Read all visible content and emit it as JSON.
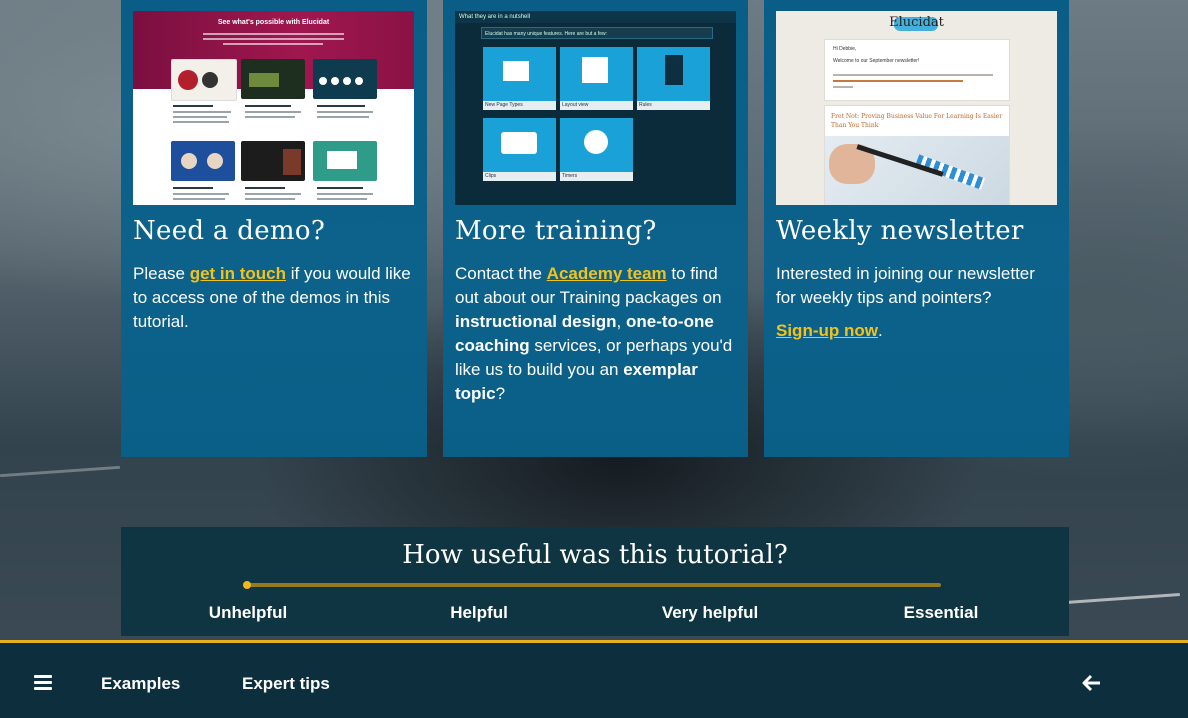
{
  "cards": [
    {
      "heading": "Need a demo?",
      "text_pre": "Please ",
      "link": "get in touch",
      "text_post": " if you would like to access one of the demos in this tutorial.",
      "thumb": {
        "hero_title": "See what's possible with Elucidat"
      }
    },
    {
      "heading": "More training?",
      "t1": "Contact the ",
      "link": "Academy team",
      "t2": " to find out about our Training packages on ",
      "b1": "instructional design",
      "t3": ", ",
      "b2": "one-to-one coaching",
      "t4": " services, or perhaps you'd like us to build you an ",
      "b3": "exemplar topic",
      "t5": "?",
      "thumb": {
        "header": "What they are in a nutshell",
        "intro": "Elucidat has many unique features. Here are but a few:",
        "tiles": [
          "New Page Types",
          "Layout view",
          "Rules",
          "Clips",
          "Timers"
        ]
      }
    },
    {
      "heading": "Weekly newsletter",
      "text": "Interested in joining our newsletter for weekly tips and pointers?",
      "link": "Sign-up now",
      "after_link": ".",
      "thumb": {
        "logo": "Elucidat",
        "greeting": "Hi Debbie,",
        "welcome": "Welcome to our September newsletter!",
        "article": "Fret Not: Proving Business Value For Learning Is Easier Than You Think"
      }
    }
  ],
  "rating": {
    "title": "How useful was this tutorial?",
    "options": [
      "Unhelpful",
      "Helpful",
      "Very helpful",
      "Essential"
    ],
    "selected": "Unhelpful"
  },
  "bottom_nav": {
    "items": [
      "Examples",
      "Expert tips"
    ],
    "menu_icon": "hamburger-icon",
    "back_icon": "arrow-left-icon"
  },
  "colors": {
    "card_bg": "#0a5d86",
    "link": "#f2c21a",
    "accent_gold": "#e7b21f",
    "panel_bg": "#0f3442"
  }
}
